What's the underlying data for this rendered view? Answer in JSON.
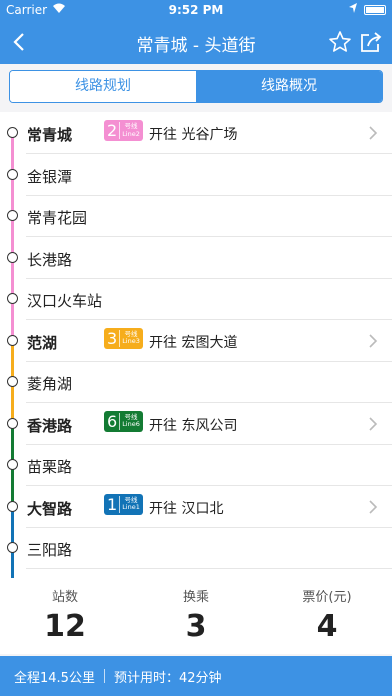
{
  "status_bar": {
    "carrier": "Carrier",
    "time": "9:52 PM"
  },
  "nav": {
    "title": "常青城 - 头道街"
  },
  "tabs": [
    {
      "label": "线路规划",
      "active": true
    },
    {
      "label": "线路概况",
      "active": false
    }
  ],
  "lines": {
    "2": {
      "color": "#f48fd2",
      "num": "2",
      "cn": "号线",
      "en": "Line2"
    },
    "3": {
      "color": "#f6ad1c",
      "num": "3",
      "cn": "号线",
      "en": "Line3"
    },
    "6": {
      "color": "#137b33",
      "num": "6",
      "cn": "号线",
      "en": "Line6"
    },
    "1": {
      "color": "#1273b6",
      "num": "1",
      "cn": "号线",
      "en": "Line1"
    }
  },
  "stations": [
    {
      "name": "常青城",
      "transfer": true,
      "line": "2",
      "direction": "开往 光谷广场"
    },
    {
      "name": "金银潭"
    },
    {
      "name": "常青花园"
    },
    {
      "name": "长港路"
    },
    {
      "name": "汉口火车站"
    },
    {
      "name": "范湖",
      "transfer": true,
      "line": "3",
      "direction": "开往 宏图大道"
    },
    {
      "name": "菱角湖"
    },
    {
      "name": "香港路",
      "transfer": true,
      "line": "6",
      "direction": "开往 东风公司"
    },
    {
      "name": "苗栗路"
    },
    {
      "name": "大智路",
      "transfer": true,
      "line": "1",
      "direction": "开往 汉口北"
    },
    {
      "name": "三阳路"
    }
  ],
  "stats": [
    {
      "label": "站数",
      "value": "12"
    },
    {
      "label": "换乘",
      "value": "3"
    },
    {
      "label": "票价(元)",
      "value": "4"
    }
  ],
  "footer": {
    "distance": "全程14.5公里",
    "time": "预计用时：42分钟"
  }
}
